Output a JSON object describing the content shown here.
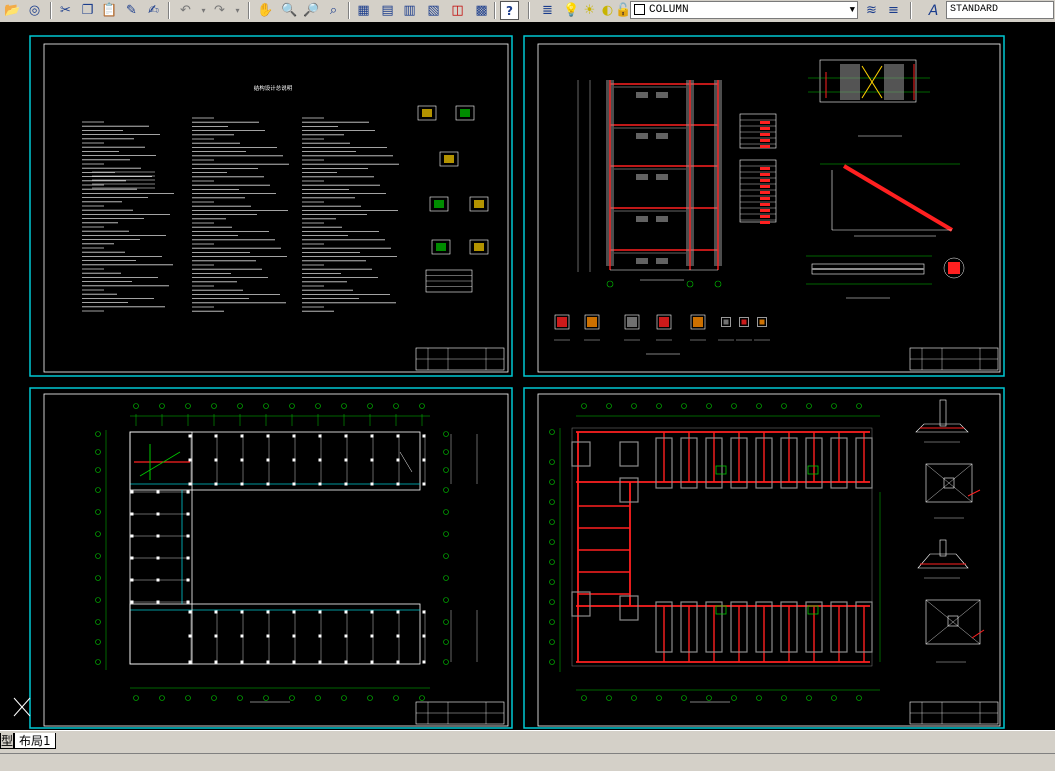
{
  "toolbar": {
    "layer_name": "COLUMN",
    "text_style": "STANDARD",
    "buttons": [
      "open-icon",
      "publish-icon",
      "cut-icon",
      "copy-icon",
      "paste-icon",
      "match-properties-icon",
      "brush-icon",
      "undo-icon",
      "redo-icon",
      "pan-icon",
      "zoom-realtime-icon",
      "zoom-window-icon",
      "zoom-previous-icon",
      "properties-icon",
      "design-center-icon",
      "tool-palettes-icon",
      "sheet-set-icon",
      "markup-icon",
      "calculator-icon",
      "help-icon"
    ]
  },
  "sheets": [
    {
      "id": "general-notes",
      "title": "结构设计总说明"
    },
    {
      "id": "stair-details",
      "title": ""
    },
    {
      "id": "floor-plan",
      "title": ""
    },
    {
      "id": "foundation-plan",
      "title": ""
    }
  ],
  "layout_tabs": {
    "model_fragment": "型",
    "layout1": "布局1"
  },
  "colors": {
    "background": "#000000",
    "viewport_border": "#00c8d2",
    "sheet_border": "#ffffff",
    "grid_line": "#00c800",
    "beam_red": "#ff2020",
    "column_gray": "#8c8c8c",
    "toolbar_gray": "#d4d0c8"
  }
}
